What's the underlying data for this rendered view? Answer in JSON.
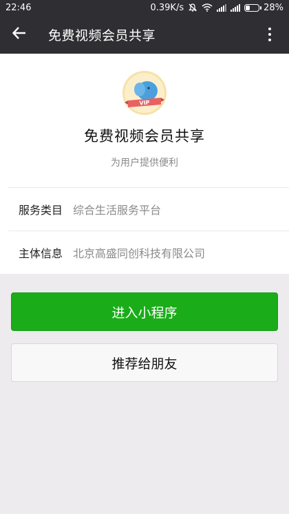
{
  "status_bar": {
    "time": "22:46",
    "network_speed": "0.39K/s",
    "battery": "28%",
    "battery_level": 0.28,
    "icons": [
      "mute-icon",
      "wifi-icon",
      "signal-icon",
      "signal-4g-icon",
      "battery-icon"
    ]
  },
  "header": {
    "title": "免费视频会员共享",
    "back_icon": "back-arrow-icon",
    "more_icon": "more-vertical-icon"
  },
  "profile": {
    "name": "免费视频会员共享",
    "description": "为用户提供便利",
    "avatar_badge": "VIP"
  },
  "info": [
    {
      "label": "服务类目",
      "value": "综合生活服务平台"
    },
    {
      "label": "主体信息",
      "value": "北京高盛同创科技有限公司"
    }
  ],
  "actions": {
    "primary": "进入小程序",
    "secondary": "推荐给朋友"
  },
  "colors": {
    "status_bar": "#2f2e33",
    "primary_button": "#1aad19",
    "background": "#edebee"
  }
}
